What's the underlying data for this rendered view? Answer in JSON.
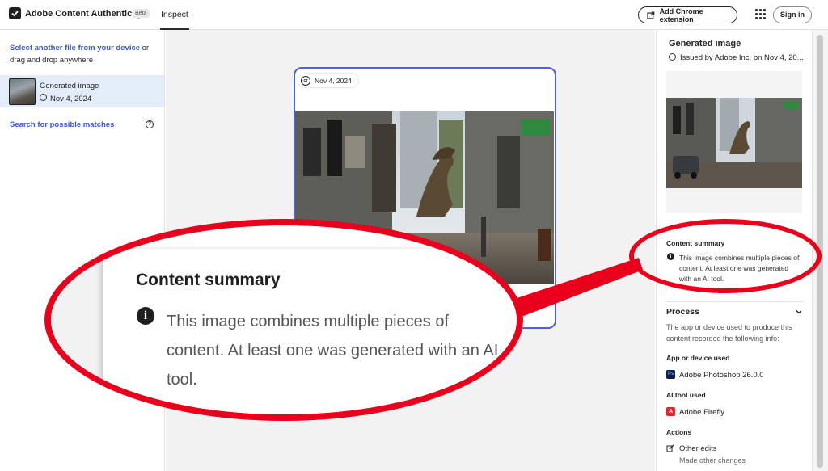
{
  "header": {
    "app_title": "Adobe Content Authenticity",
    "beta_label": "Beta",
    "tab_inspect": "Inspect",
    "chrome_extension_label": "Add Chrome extension",
    "sign_in_label": "Sign in"
  },
  "sidebar": {
    "select_link": "Select another file from your device",
    "select_rest": " or drag and drop anywhere",
    "file": {
      "name": "Generated image",
      "date": "Nov 4, 2024"
    },
    "search_matches": "Search for possible matches",
    "help_icon": "?"
  },
  "card": {
    "badge_icon": "cr",
    "date": "Nov 4, 2024"
  },
  "panel": {
    "title": "Generated image",
    "issued": "Issued by Adobe Inc. on Nov 4, 20...",
    "content_summary_heading": "Content summary",
    "info_icon": "i",
    "content_summary_text": "This image combines multiple pieces of content. At least one was generated with an AI tool.",
    "process_heading": "Process",
    "process_text": "The app or device used to produce this content recorded the following info:",
    "app_label": "App or device used",
    "ps_icon": "Ps",
    "app_value": "Adobe Photoshop 26.0.0",
    "ai_label": "AI tool used",
    "ff_icon": "A",
    "ai_value": "Adobe Firefly",
    "actions_label": "Actions",
    "action_value": "Other edits",
    "action_sub": "Made other changes"
  },
  "zoom": {
    "heading": "Content summary",
    "info_icon": "i",
    "text": "This image combines multiple pieces of content. At least one was generated with an AI tool."
  },
  "colors": {
    "accent": "#5060d8",
    "link": "#3b54d9",
    "annotation_red": "#e8001c",
    "selected_bg": "#e3edf9"
  }
}
